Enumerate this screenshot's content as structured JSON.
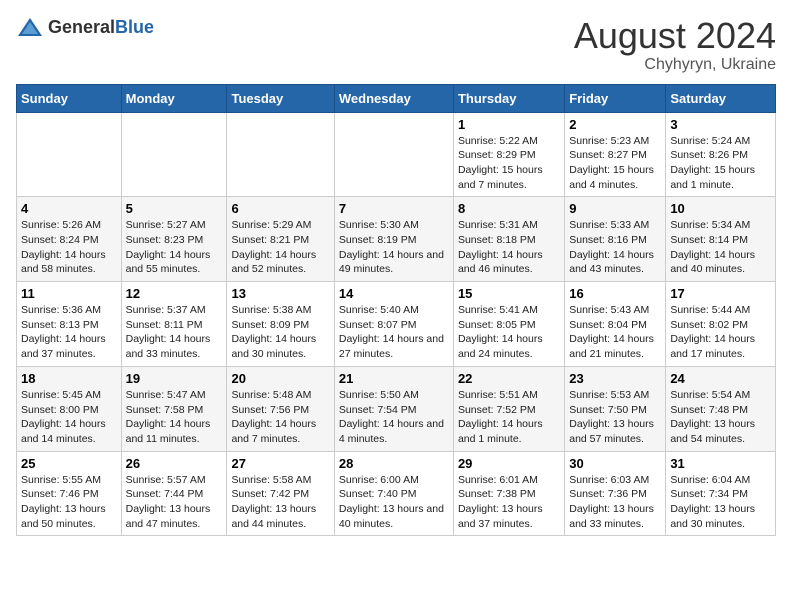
{
  "logo": {
    "general": "General",
    "blue": "Blue"
  },
  "title": "August 2024",
  "subtitle": "Chyhyryn, Ukraine",
  "days_of_week": [
    "Sunday",
    "Monday",
    "Tuesday",
    "Wednesday",
    "Thursday",
    "Friday",
    "Saturday"
  ],
  "weeks": [
    [
      {
        "day": "",
        "info": ""
      },
      {
        "day": "",
        "info": ""
      },
      {
        "day": "",
        "info": ""
      },
      {
        "day": "",
        "info": ""
      },
      {
        "day": "1",
        "info": "Sunrise: 5:22 AM\nSunset: 8:29 PM\nDaylight: 15 hours and 7 minutes."
      },
      {
        "day": "2",
        "info": "Sunrise: 5:23 AM\nSunset: 8:27 PM\nDaylight: 15 hours and 4 minutes."
      },
      {
        "day": "3",
        "info": "Sunrise: 5:24 AM\nSunset: 8:26 PM\nDaylight: 15 hours and 1 minute."
      }
    ],
    [
      {
        "day": "4",
        "info": "Sunrise: 5:26 AM\nSunset: 8:24 PM\nDaylight: 14 hours and 58 minutes."
      },
      {
        "day": "5",
        "info": "Sunrise: 5:27 AM\nSunset: 8:23 PM\nDaylight: 14 hours and 55 minutes."
      },
      {
        "day": "6",
        "info": "Sunrise: 5:29 AM\nSunset: 8:21 PM\nDaylight: 14 hours and 52 minutes."
      },
      {
        "day": "7",
        "info": "Sunrise: 5:30 AM\nSunset: 8:19 PM\nDaylight: 14 hours and 49 minutes."
      },
      {
        "day": "8",
        "info": "Sunrise: 5:31 AM\nSunset: 8:18 PM\nDaylight: 14 hours and 46 minutes."
      },
      {
        "day": "9",
        "info": "Sunrise: 5:33 AM\nSunset: 8:16 PM\nDaylight: 14 hours and 43 minutes."
      },
      {
        "day": "10",
        "info": "Sunrise: 5:34 AM\nSunset: 8:14 PM\nDaylight: 14 hours and 40 minutes."
      }
    ],
    [
      {
        "day": "11",
        "info": "Sunrise: 5:36 AM\nSunset: 8:13 PM\nDaylight: 14 hours and 37 minutes."
      },
      {
        "day": "12",
        "info": "Sunrise: 5:37 AM\nSunset: 8:11 PM\nDaylight: 14 hours and 33 minutes."
      },
      {
        "day": "13",
        "info": "Sunrise: 5:38 AM\nSunset: 8:09 PM\nDaylight: 14 hours and 30 minutes."
      },
      {
        "day": "14",
        "info": "Sunrise: 5:40 AM\nSunset: 8:07 PM\nDaylight: 14 hours and 27 minutes."
      },
      {
        "day": "15",
        "info": "Sunrise: 5:41 AM\nSunset: 8:05 PM\nDaylight: 14 hours and 24 minutes."
      },
      {
        "day": "16",
        "info": "Sunrise: 5:43 AM\nSunset: 8:04 PM\nDaylight: 14 hours and 21 minutes."
      },
      {
        "day": "17",
        "info": "Sunrise: 5:44 AM\nSunset: 8:02 PM\nDaylight: 14 hours and 17 minutes."
      }
    ],
    [
      {
        "day": "18",
        "info": "Sunrise: 5:45 AM\nSunset: 8:00 PM\nDaylight: 14 hours and 14 minutes."
      },
      {
        "day": "19",
        "info": "Sunrise: 5:47 AM\nSunset: 7:58 PM\nDaylight: 14 hours and 11 minutes."
      },
      {
        "day": "20",
        "info": "Sunrise: 5:48 AM\nSunset: 7:56 PM\nDaylight: 14 hours and 7 minutes."
      },
      {
        "day": "21",
        "info": "Sunrise: 5:50 AM\nSunset: 7:54 PM\nDaylight: 14 hours and 4 minutes."
      },
      {
        "day": "22",
        "info": "Sunrise: 5:51 AM\nSunset: 7:52 PM\nDaylight: 14 hours and 1 minute."
      },
      {
        "day": "23",
        "info": "Sunrise: 5:53 AM\nSunset: 7:50 PM\nDaylight: 13 hours and 57 minutes."
      },
      {
        "day": "24",
        "info": "Sunrise: 5:54 AM\nSunset: 7:48 PM\nDaylight: 13 hours and 54 minutes."
      }
    ],
    [
      {
        "day": "25",
        "info": "Sunrise: 5:55 AM\nSunset: 7:46 PM\nDaylight: 13 hours and 50 minutes."
      },
      {
        "day": "26",
        "info": "Sunrise: 5:57 AM\nSunset: 7:44 PM\nDaylight: 13 hours and 47 minutes."
      },
      {
        "day": "27",
        "info": "Sunrise: 5:58 AM\nSunset: 7:42 PM\nDaylight: 13 hours and 44 minutes."
      },
      {
        "day": "28",
        "info": "Sunrise: 6:00 AM\nSunset: 7:40 PM\nDaylight: 13 hours and 40 minutes."
      },
      {
        "day": "29",
        "info": "Sunrise: 6:01 AM\nSunset: 7:38 PM\nDaylight: 13 hours and 37 minutes."
      },
      {
        "day": "30",
        "info": "Sunrise: 6:03 AM\nSunset: 7:36 PM\nDaylight: 13 hours and 33 minutes."
      },
      {
        "day": "31",
        "info": "Sunrise: 6:04 AM\nSunset: 7:34 PM\nDaylight: 13 hours and 30 minutes."
      }
    ]
  ]
}
